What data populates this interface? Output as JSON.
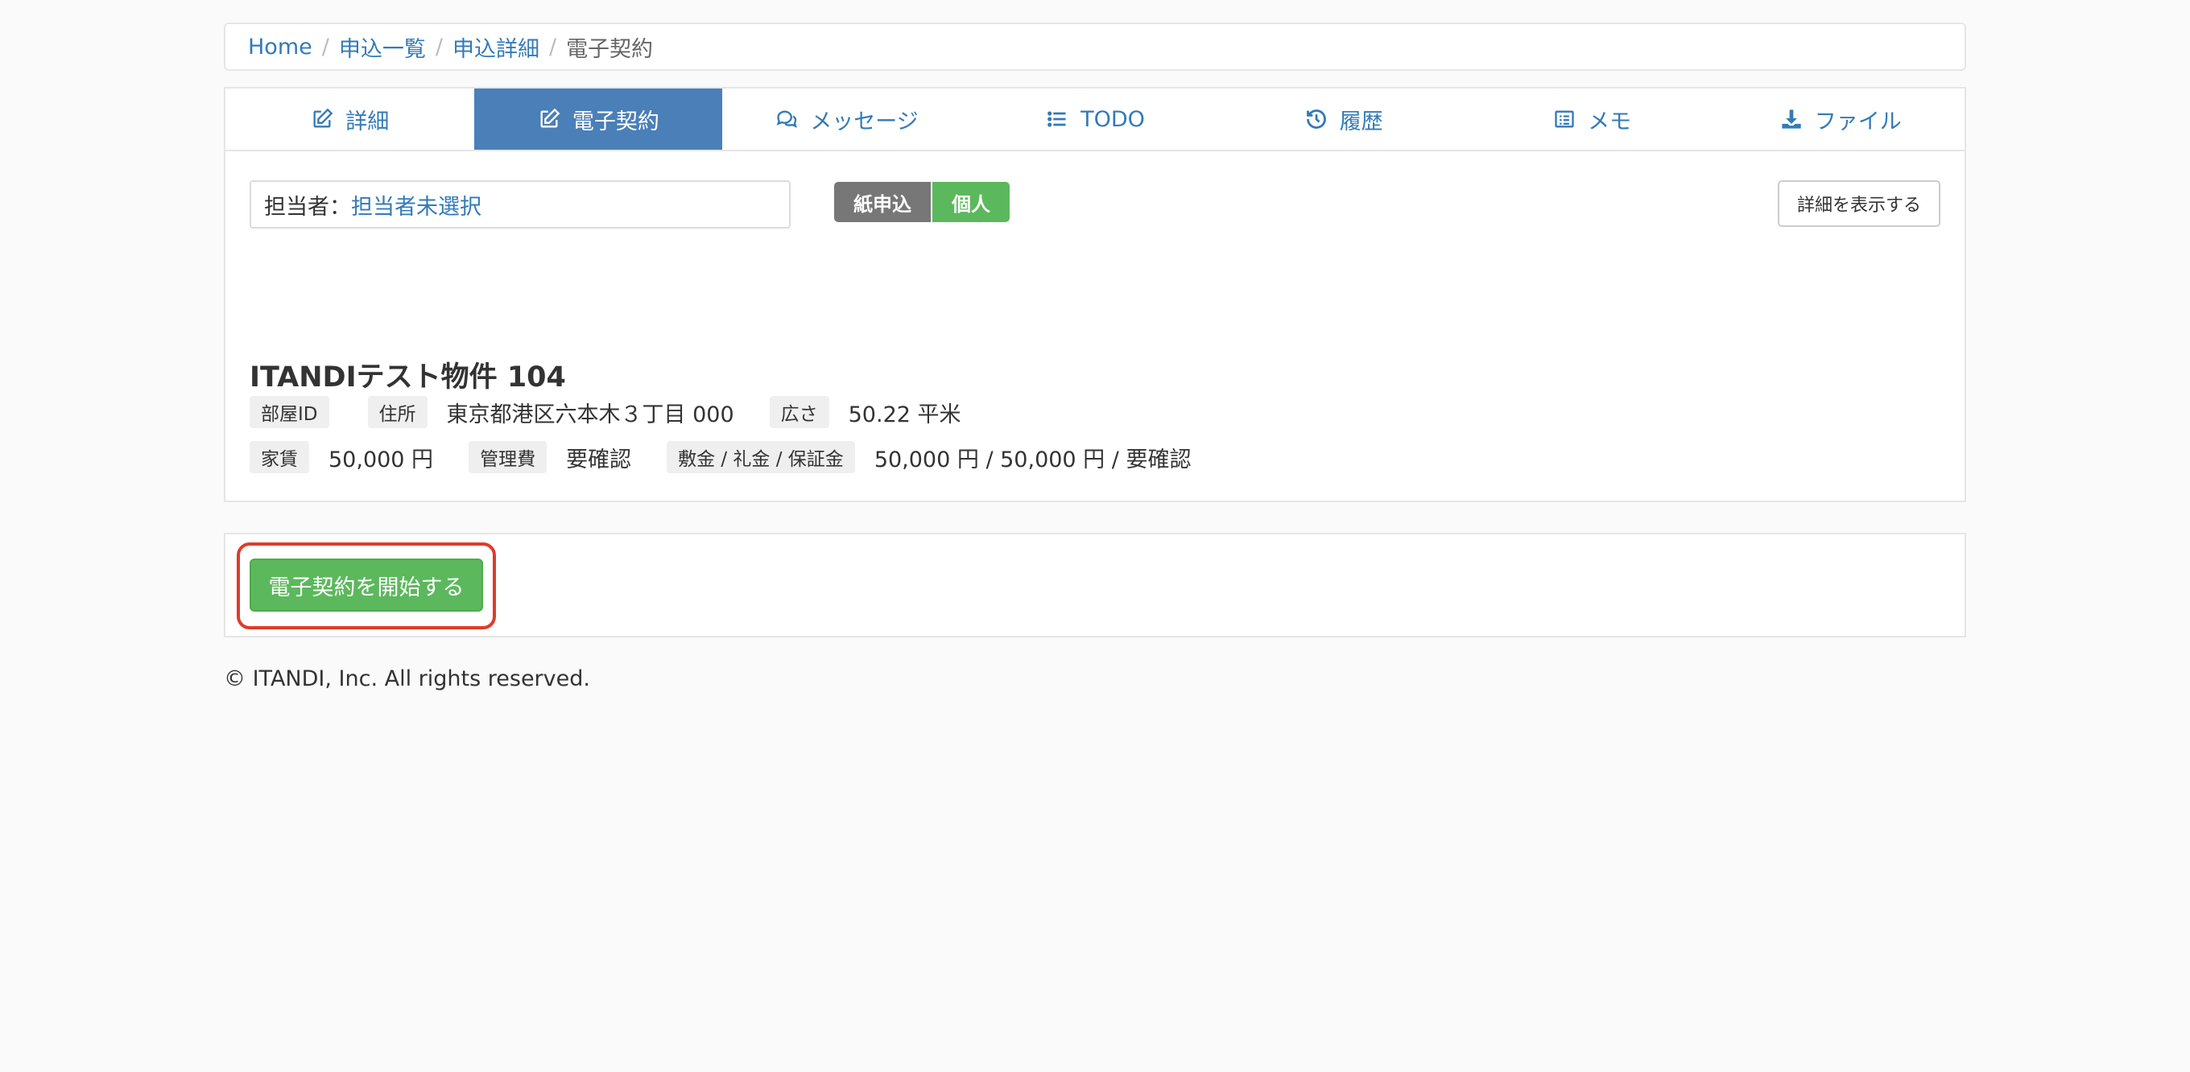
{
  "breadcrumb": {
    "items": [
      "Home",
      "申込一覧",
      "申込詳細"
    ],
    "current": "電子契約"
  },
  "tabs": [
    {
      "label": "詳細",
      "icon": "edit-icon"
    },
    {
      "label": "電子契約",
      "icon": "edit-icon",
      "active": true
    },
    {
      "label": "メッセージ",
      "icon": "comments-icon"
    },
    {
      "label": "TODO",
      "icon": "list-icon"
    },
    {
      "label": "履歴",
      "icon": "history-icon"
    },
    {
      "label": "メモ",
      "icon": "memo-icon"
    },
    {
      "label": "ファイル",
      "icon": "download-icon"
    }
  ],
  "assignee": {
    "label": "担当者：",
    "value": "担当者未選択"
  },
  "badges": {
    "type": "紙申込",
    "category": "個人"
  },
  "detail_button": "詳細を表示する",
  "property": {
    "title": "ITANDIテスト物件 104",
    "room_id_label": "部屋ID",
    "room_id_value": "",
    "address_label": "住所",
    "address_value": "東京都港区六本木３丁目 000",
    "area_label": "広さ",
    "area_value": "50.22 平米",
    "rent_label": "家賃",
    "rent_value": "50,000 円",
    "fee_label": "管理費",
    "fee_value": "要確認",
    "deposit_label": "敷金 / 礼金 / 保証金",
    "deposit_value": "50,000 円 / 50,000 円 / 要確認"
  },
  "action": {
    "start_button": "電子契約を開始する"
  },
  "footer": "© ITANDI, Inc. All rights reserved.",
  "colors": {
    "accent": "#337ab7",
    "active_tab": "#4a7fb8",
    "success": "#5cb85c",
    "highlight": "#e03b2a"
  }
}
